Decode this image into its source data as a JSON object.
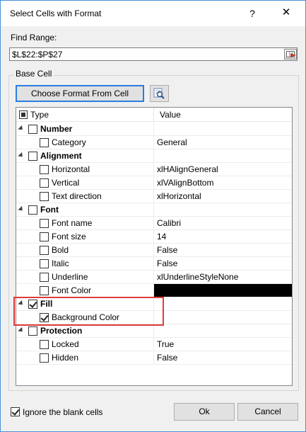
{
  "window": {
    "title": "Select Cells with Format",
    "help_glyph": "?",
    "close_glyph": "✕"
  },
  "find_range": {
    "label": "Find Range:",
    "value": "$L$22:$P$27"
  },
  "base_cell": {
    "label": "Base Cell",
    "choose_button": "Choose Format From Cell"
  },
  "tree": {
    "columns": {
      "type": "Type",
      "value": "Value"
    },
    "rows": [
      {
        "label": "Number",
        "value": "",
        "level": 0,
        "checked": false
      },
      {
        "label": "Category",
        "value": "General",
        "level": 1,
        "checked": false
      },
      {
        "label": "Alignment",
        "value": "",
        "level": 0,
        "checked": false
      },
      {
        "label": "Horizontal",
        "value": "xlHAlignGeneral",
        "level": 1,
        "checked": false
      },
      {
        "label": "Vertical",
        "value": "xlVAlignBottom",
        "level": 1,
        "checked": false
      },
      {
        "label": "Text direction",
        "value": "xlHorizontal",
        "level": 1,
        "checked": false
      },
      {
        "label": "Font",
        "value": "",
        "level": 0,
        "checked": false
      },
      {
        "label": "Font name",
        "value": "Calibri",
        "level": 1,
        "checked": false
      },
      {
        "label": "Font size",
        "value": "14",
        "level": 1,
        "checked": false
      },
      {
        "label": "Bold",
        "value": "False",
        "level": 1,
        "checked": false
      },
      {
        "label": "Italic",
        "value": "False",
        "level": 1,
        "checked": false
      },
      {
        "label": "Underline",
        "value": "xlUnderlineStyleNone",
        "level": 1,
        "checked": false
      },
      {
        "label": "Font Color",
        "value": "",
        "level": 1,
        "checked": false,
        "swatch": "#000000"
      },
      {
        "label": "Fill",
        "value": "",
        "level": 0,
        "checked": true
      },
      {
        "label": "Background Color",
        "value": "",
        "level": 1,
        "checked": true
      },
      {
        "label": "Protection",
        "value": "",
        "level": 0,
        "checked": false
      },
      {
        "label": "Locked",
        "value": "True",
        "level": 1,
        "checked": false
      },
      {
        "label": "Hidden",
        "value": "False",
        "level": 1,
        "checked": false
      }
    ]
  },
  "footer": {
    "ignore_blank_label": "Ignore the blank cells",
    "ignore_blank_checked": true,
    "ok_label": "Ok",
    "cancel_label": "Cancel"
  },
  "colors": {
    "highlight": "#e03a3a",
    "accent": "#2a7de1"
  }
}
